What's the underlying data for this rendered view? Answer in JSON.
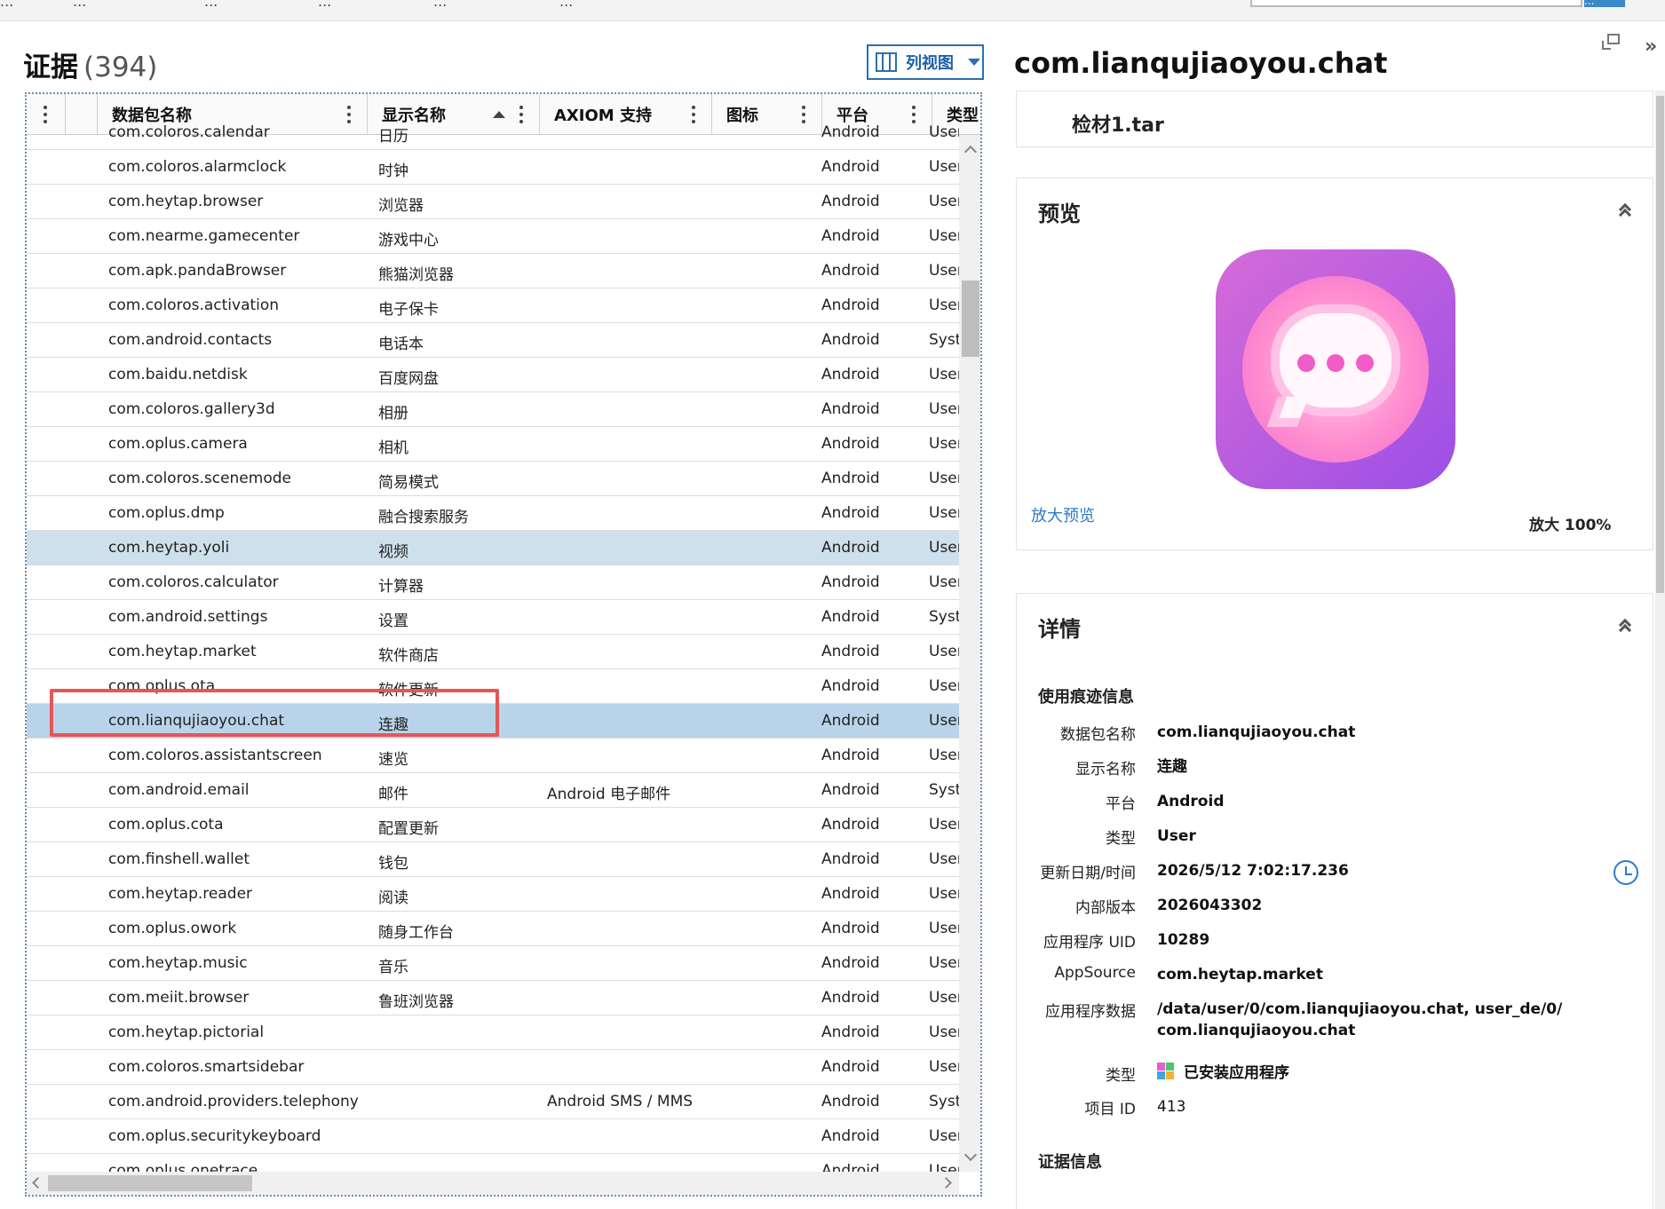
{
  "topbar": {
    "tabs": [
      "...",
      "...",
      "...",
      "...",
      "...",
      "..."
    ],
    "search_button": "..."
  },
  "evidence": {
    "title": "证据",
    "count": "(394)",
    "view_button": "列视图",
    "columns": [
      "数据包名称",
      "显示名称",
      "AXIOM 支持",
      "图标",
      "平台",
      "类型"
    ],
    "rows": [
      {
        "pkg": "com.coloros.calendar",
        "name": "日历",
        "axiom": "",
        "platform": "Android",
        "type": "User"
      },
      {
        "pkg": "com.coloros.alarmclock",
        "name": "时钟",
        "axiom": "",
        "platform": "Android",
        "type": "User"
      },
      {
        "pkg": "com.heytap.browser",
        "name": "浏览器",
        "axiom": "",
        "platform": "Android",
        "type": "User"
      },
      {
        "pkg": "com.nearme.gamecenter",
        "name": "游戏中心",
        "axiom": "",
        "platform": "Android",
        "type": "User"
      },
      {
        "pkg": "com.apk.pandaBrowser",
        "name": "熊猫浏览器",
        "axiom": "",
        "platform": "Android",
        "type": "User"
      },
      {
        "pkg": "com.coloros.activation",
        "name": "电子保卡",
        "axiom": "",
        "platform": "Android",
        "type": "User"
      },
      {
        "pkg": "com.android.contacts",
        "name": "电话本",
        "axiom": "",
        "platform": "Android",
        "type": "System"
      },
      {
        "pkg": "com.baidu.netdisk",
        "name": "百度网盘",
        "axiom": "",
        "platform": "Android",
        "type": "User"
      },
      {
        "pkg": "com.coloros.gallery3d",
        "name": "相册",
        "axiom": "",
        "platform": "Android",
        "type": "User"
      },
      {
        "pkg": "com.oplus.camera",
        "name": "相机",
        "axiom": "",
        "platform": "Android",
        "type": "User"
      },
      {
        "pkg": "com.coloros.scenemode",
        "name": "简易模式",
        "axiom": "",
        "platform": "Android",
        "type": "User"
      },
      {
        "pkg": "com.oplus.dmp",
        "name": "融合搜索服务",
        "axiom": "",
        "platform": "Android",
        "type": "User"
      },
      {
        "pkg": "com.heytap.yoli",
        "name": "视频",
        "axiom": "",
        "platform": "Android",
        "type": "User"
      },
      {
        "pkg": "com.coloros.calculator",
        "name": "计算器",
        "axiom": "",
        "platform": "Android",
        "type": "User"
      },
      {
        "pkg": "com.android.settings",
        "name": "设置",
        "axiom": "",
        "platform": "Android",
        "type": "System"
      },
      {
        "pkg": "com.heytap.market",
        "name": "软件商店",
        "axiom": "",
        "platform": "Android",
        "type": "User"
      },
      {
        "pkg": "com.oplus.ota",
        "name": "软件更新",
        "axiom": "",
        "platform": "Android",
        "type": "User"
      },
      {
        "pkg": "com.lianqujiaoyou.chat",
        "name": "连趣",
        "axiom": "",
        "platform": "Android",
        "type": "User"
      },
      {
        "pkg": "com.coloros.assistantscreen",
        "name": "速览",
        "axiom": "",
        "platform": "Android",
        "type": "User"
      },
      {
        "pkg": "com.android.email",
        "name": "邮件",
        "axiom": "Android 电子邮件",
        "platform": "Android",
        "type": "System"
      },
      {
        "pkg": "com.oplus.cota",
        "name": "配置更新",
        "axiom": "",
        "platform": "Android",
        "type": "User"
      },
      {
        "pkg": "com.finshell.wallet",
        "name": "钱包",
        "axiom": "",
        "platform": "Android",
        "type": "User"
      },
      {
        "pkg": "com.heytap.reader",
        "name": "阅读",
        "axiom": "",
        "platform": "Android",
        "type": "User"
      },
      {
        "pkg": "com.oplus.owork",
        "name": "随身工作台",
        "axiom": "",
        "platform": "Android",
        "type": "User"
      },
      {
        "pkg": "com.heytap.music",
        "name": "音乐",
        "axiom": "",
        "platform": "Android",
        "type": "User"
      },
      {
        "pkg": "com.meiit.browser",
        "name": "鲁班浏览器",
        "axiom": "",
        "platform": "Android",
        "type": "User"
      },
      {
        "pkg": "com.heytap.pictorial",
        "name": "",
        "axiom": "",
        "platform": "Android",
        "type": "User"
      },
      {
        "pkg": "com.coloros.smartsidebar",
        "name": "",
        "axiom": "",
        "platform": "Android",
        "type": "User"
      },
      {
        "pkg": "com.android.providers.telephony",
        "name": "",
        "axiom": "Android SMS / MMS",
        "platform": "Android",
        "type": "System"
      },
      {
        "pkg": "com.oplus.securitykeyboard",
        "name": "",
        "axiom": "",
        "platform": "Android",
        "type": "User"
      },
      {
        "pkg": "com.oplus.onetrace",
        "name": "",
        "axiom": "",
        "platform": "Android",
        "type": "User"
      }
    ]
  },
  "detail": {
    "title": "com.lianqujiaoyou.chat",
    "source": "检材1.tar",
    "preview_heading": "预览",
    "zoom_link": "放大预览",
    "zoom_value": "放大 100%",
    "details_heading": "详情",
    "usage_heading": "使用痕迹信息",
    "fields": [
      {
        "k": "数据包名称",
        "v": "com.lianqujiaoyou.chat"
      },
      {
        "k": "显示名称",
        "v": "连趣"
      },
      {
        "k": "平台",
        "v": "Android"
      },
      {
        "k": "类型",
        "v": "User"
      },
      {
        "k": "更新日期/时间",
        "v": "2026/5/12 7:02:17.236"
      },
      {
        "k": "内部版本",
        "v": "2026043302"
      },
      {
        "k": "应用程序 UID",
        "v": "10289"
      },
      {
        "k": "AppSource",
        "v": "com.heytap.market"
      },
      {
        "k": "应用程序数据",
        "v": "/data/user/0/com.lianqujiaoyou.chat, user_de/0/\ncom.lianqujiaoyou.chat"
      },
      {
        "k": "类型",
        "v": "已安装应用程序"
      },
      {
        "k": "项目 ID",
        "v": "413"
      }
    ],
    "evidence_heading": "证据信息"
  },
  "colors": {
    "accent": "#2a6fb0",
    "selected_row": "#cfe0ed",
    "focused_row": "#b9d4ea",
    "highlight": "#e55656",
    "link": "#2e7bc6"
  },
  "icons": [
    "kebab-icon",
    "sort-up-icon",
    "columns-icon",
    "caret-down-icon",
    "restore-window-icon",
    "double-chevron-right-icon",
    "collapse-up-icon",
    "clock-icon",
    "installed-app-icon",
    "app-icon"
  ]
}
